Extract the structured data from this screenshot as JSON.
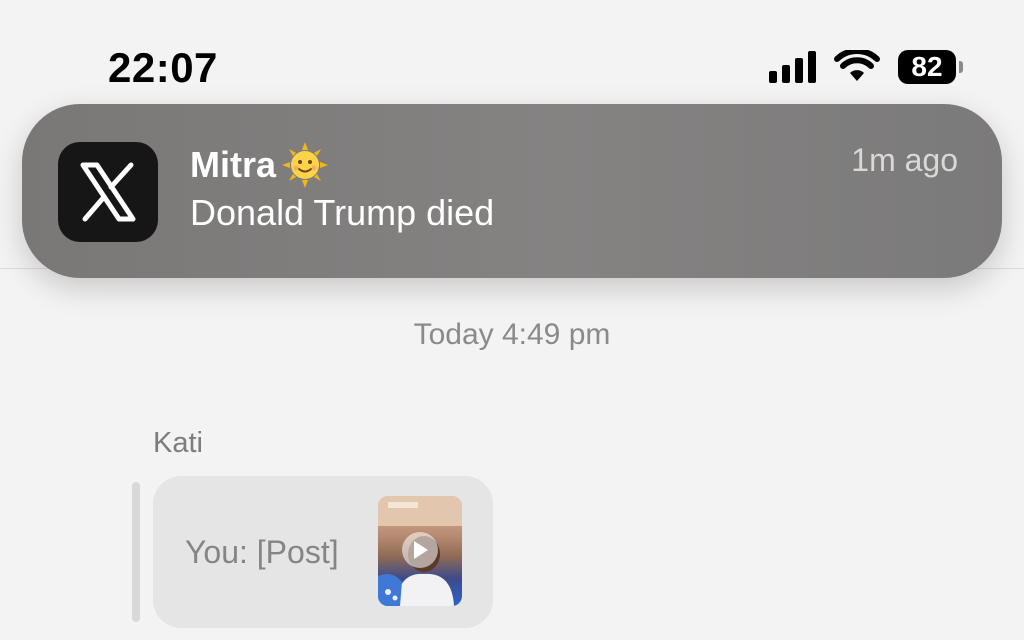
{
  "status_bar": {
    "time": "22:07",
    "battery": "82",
    "icons": [
      "signal-icon",
      "wifi-icon",
      "battery-icon"
    ]
  },
  "notification": {
    "app_icon": "x-logo-icon",
    "sender": "Mitra",
    "sender_emoji": "sun-with-face-icon",
    "message": "Donald Trump died",
    "time": "1m ago"
  },
  "chat": {
    "timestamp": "Today 4:49 pm",
    "sender": "Kati",
    "bubble_text": "You: [Post]",
    "thumbnail_icon": "play-icon"
  },
  "colors": {
    "banner": "#807e7d",
    "background": "#f3f3f3",
    "bubble": "#e5e5e5"
  }
}
